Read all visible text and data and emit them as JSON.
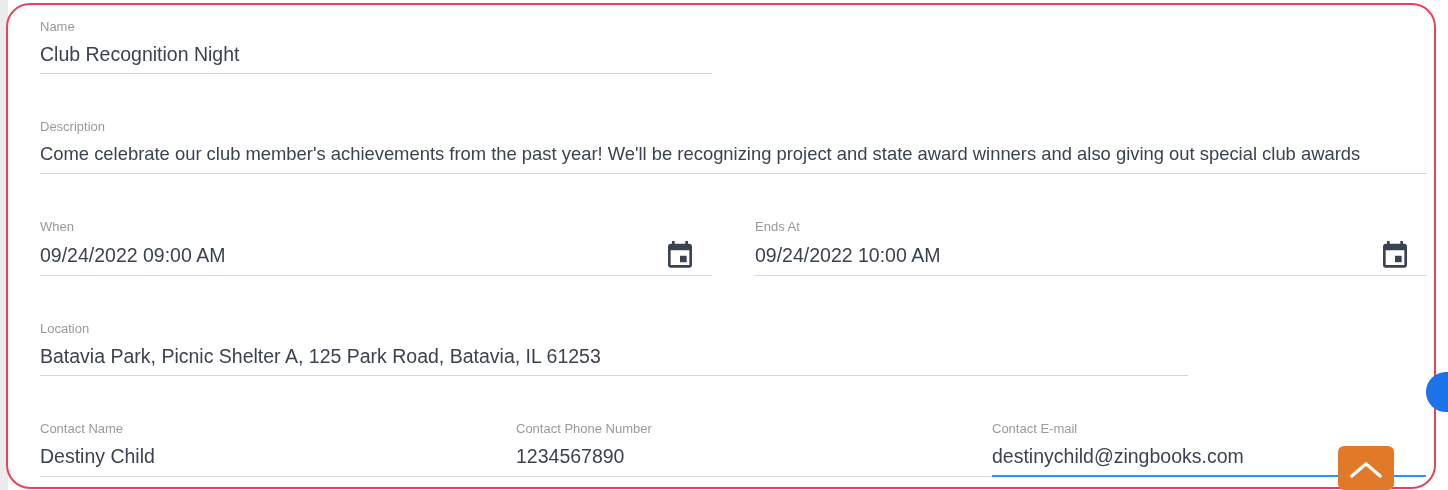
{
  "rows": [
    {
      "fields": [
        {
          "kind": "text",
          "label": "Name",
          "value": "Club Recognition Night",
          "focused": false
        }
      ]
    },
    {
      "fields": [
        {
          "kind": "text",
          "label": "Description",
          "value": "Come celebrate our club member's achievements from the past year! We'll be recognizing project and state award winners and also giving out special club awards",
          "focused": false
        }
      ]
    },
    {
      "fields": [
        {
          "kind": "date",
          "label": "When",
          "value": "09/24/2022 09:00 AM",
          "focused": false
        },
        {
          "kind": "date",
          "label": "Ends At",
          "value": "09/24/2022 10:00 AM",
          "focused": false
        }
      ]
    },
    {
      "fields": [
        {
          "kind": "text",
          "label": "Location",
          "value": "Batavia Park, Picnic Shelter A, 125 Park Road, Batavia, IL 61253",
          "focused": false
        }
      ]
    },
    {
      "fields": [
        {
          "kind": "text",
          "label": "Contact Name",
          "value": "Destiny Child",
          "focused": false
        },
        {
          "kind": "text",
          "label": "Contact Phone Number",
          "value": "1234567890",
          "focused": false
        },
        {
          "kind": "text",
          "label": "Contact E-mail",
          "value": "destinychild@zingbooks.com",
          "focused": true
        }
      ]
    }
  ]
}
